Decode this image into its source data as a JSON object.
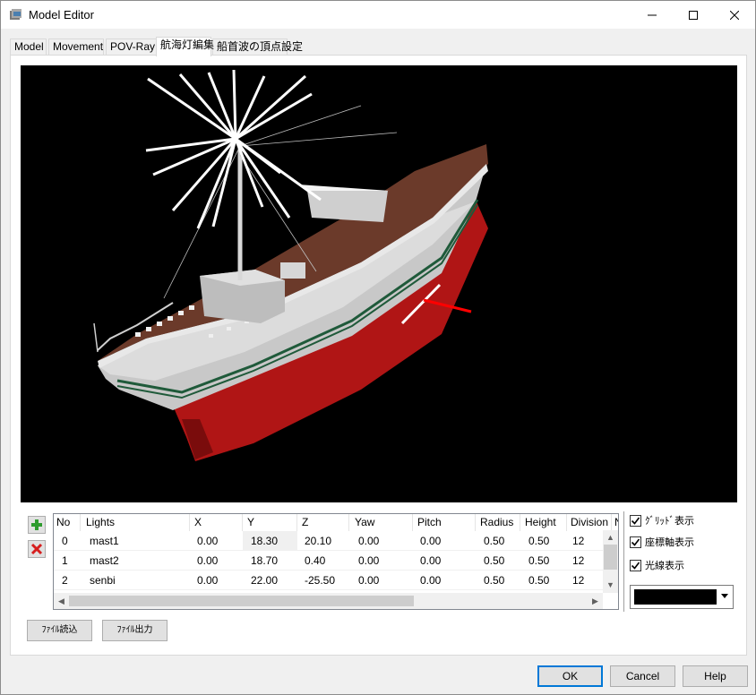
{
  "window": {
    "title": "Model Editor"
  },
  "tabs": [
    {
      "label": "Model"
    },
    {
      "label": "Movement"
    },
    {
      "label": "POV-Ray"
    },
    {
      "label": "航海灯編集"
    },
    {
      "label": "船首波の頂点設定"
    }
  ],
  "active_tab": 3,
  "grid": {
    "columns": [
      "No",
      "Lights",
      "X",
      "Y",
      "Z",
      "Yaw",
      "Pitch",
      "Radius",
      "Height",
      "Division",
      "N"
    ],
    "rows": [
      [
        "0",
        "mast1",
        "0.00",
        "18.30",
        "20.10",
        "0.00",
        "0.00",
        "0.50",
        "0.50",
        "12"
      ],
      [
        "1",
        "mast2",
        "0.00",
        "18.70",
        "0.40",
        "0.00",
        "0.00",
        "0.50",
        "0.50",
        "12"
      ],
      [
        "2",
        "senbi",
        "0.00",
        "22.00",
        "-25.50",
        "0.00",
        "0.00",
        "0.50",
        "0.50",
        "12"
      ]
    ]
  },
  "options": {
    "grid_display": "ｸﾞﾘｯﾄﾞ表示",
    "axis_display": "座標軸表示",
    "ray_display": "光線表示"
  },
  "light_color": "#000000",
  "buttons": {
    "file_load": "ﾌｧｲﾙ読込",
    "file_save": "ﾌｧｲﾙ出力",
    "ok": "OK",
    "cancel": "Cancel",
    "help": "Help"
  },
  "colors": {
    "hull_red": "#b01515",
    "deck_brown": "#6b3a2a",
    "stripe_green": "#1f5a3a",
    "axis_red": "#ff0000"
  }
}
